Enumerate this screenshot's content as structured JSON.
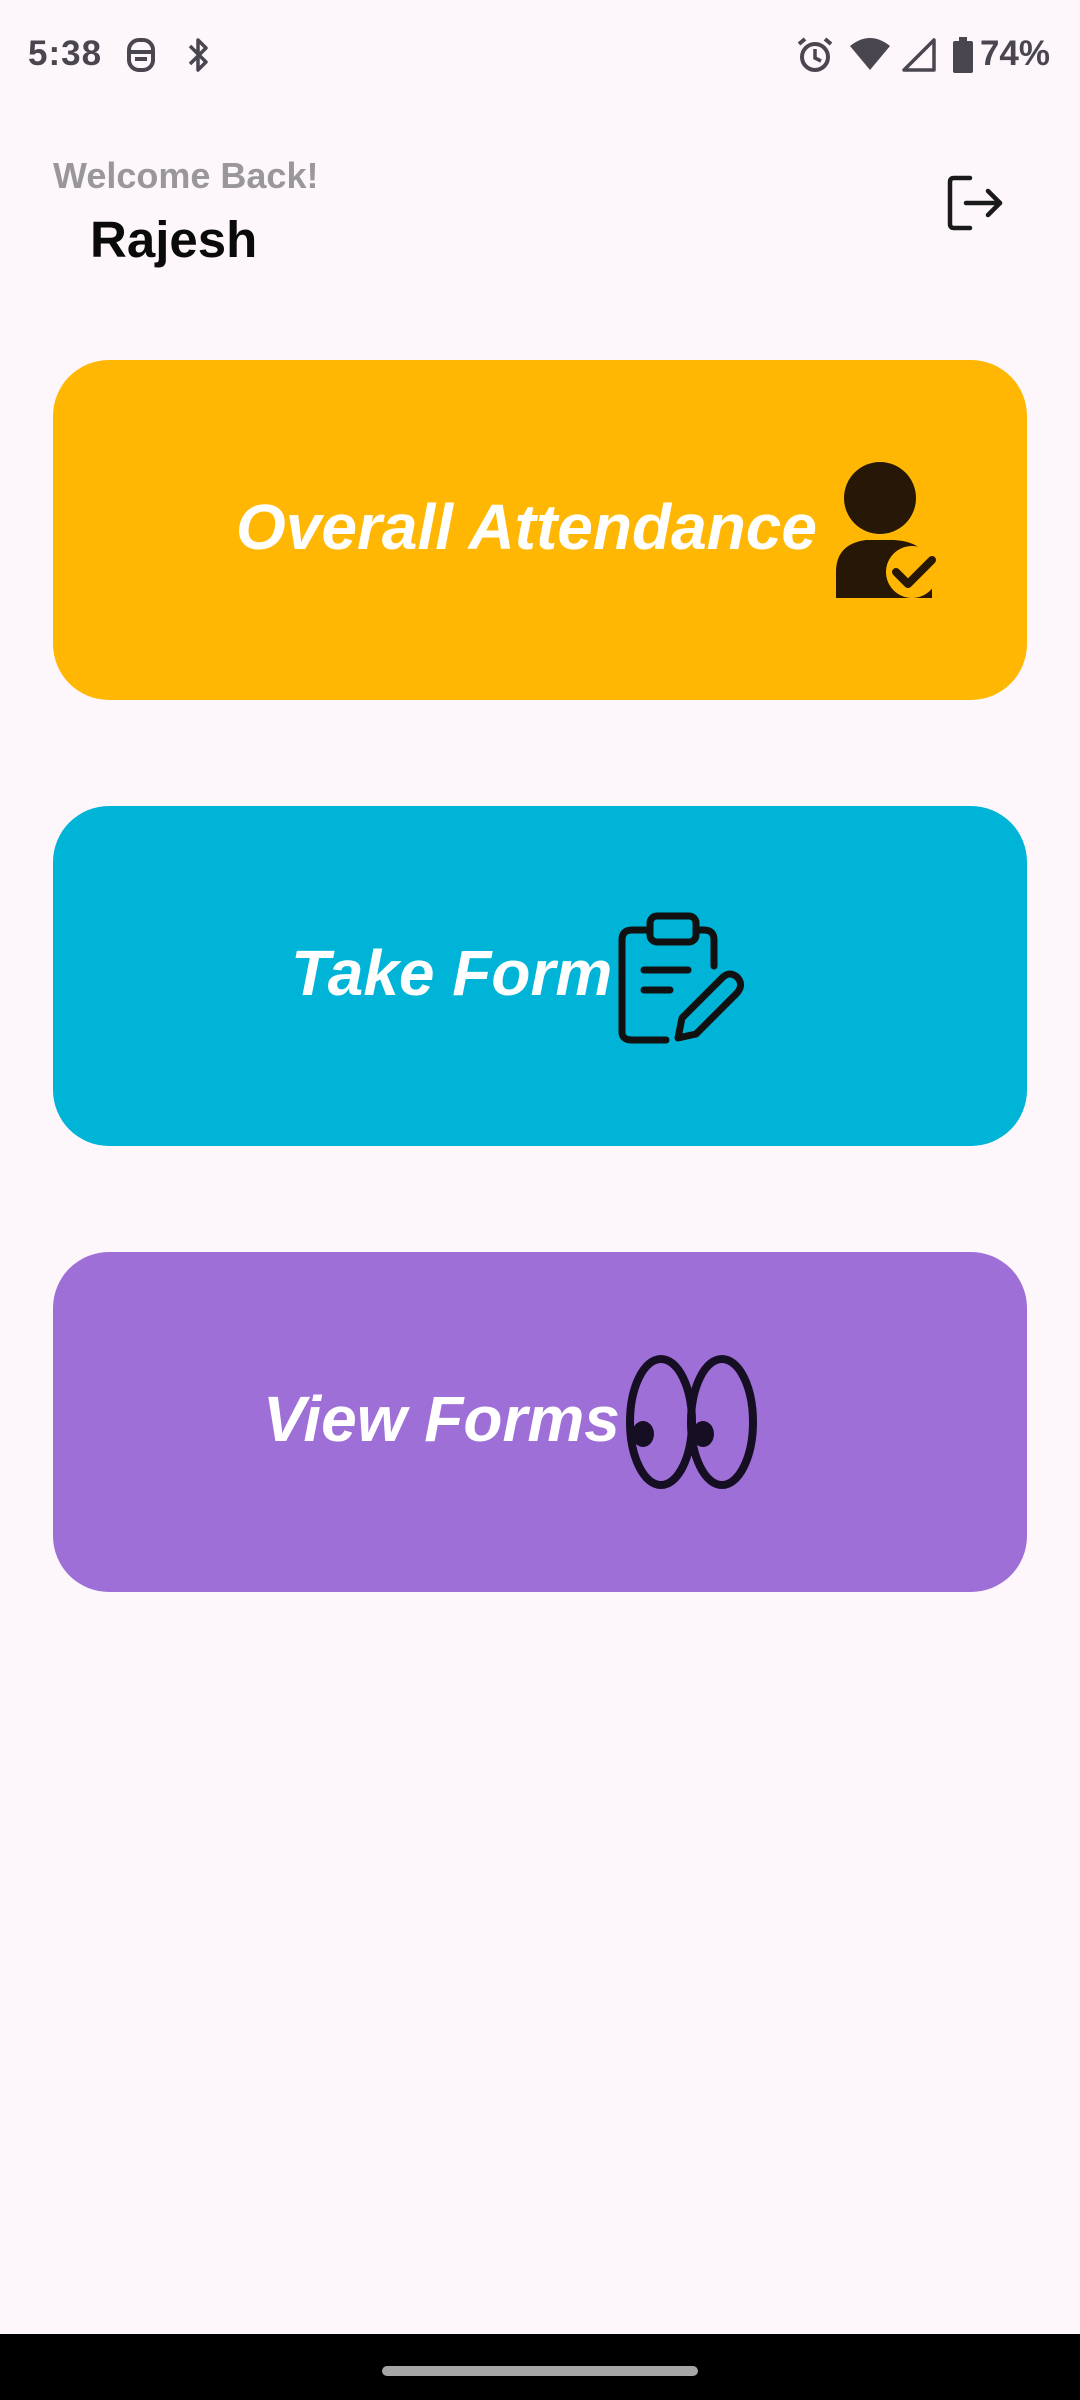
{
  "status_bar": {
    "time": "5:38",
    "battery": "74%",
    "icons": [
      "notification-badge-icon",
      "bluetooth-icon",
      "alarm-icon",
      "wifi-icon",
      "signal-icon",
      "battery-icon"
    ]
  },
  "header": {
    "welcome": "Welcome Back!",
    "username": "Rajesh",
    "logout_icon": "logout-icon"
  },
  "cards": [
    {
      "label": "Overall Attendance",
      "color": "#ffb703",
      "icon": "user-check-icon"
    },
    {
      "label": "Take Form",
      "color": "#00b4d8",
      "icon": "clipboard-edit-icon"
    },
    {
      "label": "View Forms",
      "color": "#9f6fd8",
      "icon": "eyes-icon"
    }
  ]
}
